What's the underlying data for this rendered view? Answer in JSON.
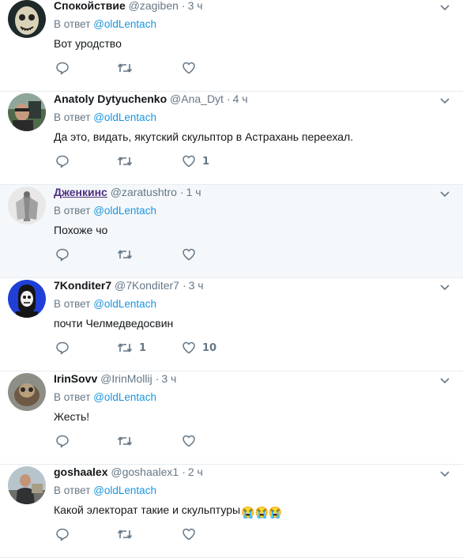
{
  "reply_prefix": "В ответ",
  "reply_target": "@oldLentach",
  "tweets": [
    {
      "name": "Спокойствие",
      "handle": "@zagiben",
      "dot": "·",
      "time": "3 ч",
      "text": "Вот уродство",
      "retweets": "",
      "likes": ""
    },
    {
      "name": "Anatoly Dytyuchenko",
      "handle": "@Ana_Dyt",
      "dot": "·",
      "time": "4 ч",
      "text": "Да это, видать, якутский скульптор в Астрахань переехал.",
      "retweets": "",
      "likes": "1"
    },
    {
      "name": "Дженкинс",
      "handle": "@zaratushtro",
      "dot": "·",
      "time": "1 ч",
      "text": "Похоже чо",
      "retweets": "",
      "likes": ""
    },
    {
      "name": "7Konditer7",
      "handle": "@7Konditer7",
      "dot": "·",
      "time": "3 ч",
      "text": "почти Челмедведосвин",
      "retweets": "1",
      "likes": "10"
    },
    {
      "name": "IrinSovv",
      "handle": "@IrinMollij",
      "dot": "·",
      "time": "3 ч",
      "text": "Жесть!",
      "retweets": "",
      "likes": ""
    },
    {
      "name": "goshaalex",
      "handle": "@goshaalex1",
      "dot": "·",
      "time": "2 ч",
      "text": "Какой электорат такие и скульптуры",
      "emoji": "😭😭😭",
      "retweets": "",
      "likes": ""
    }
  ],
  "icons": {
    "reply": "reply-icon",
    "retweet": "retweet-icon",
    "like": "heart-icon",
    "menu": "chevron-down-icon"
  },
  "colors": {
    "secondary": "#657786",
    "link": "#1b95e0",
    "highlight_bg": "#f5f8fa",
    "visited_name": "#4d2f82"
  }
}
